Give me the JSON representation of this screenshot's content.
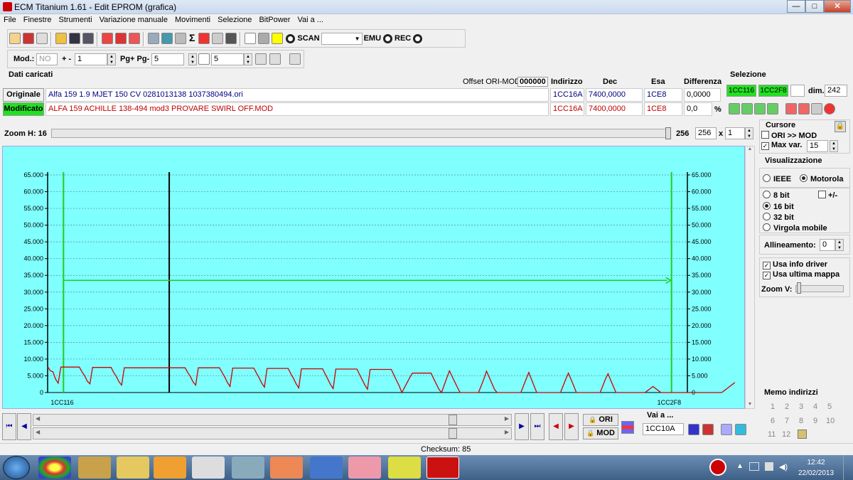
{
  "window": {
    "title": "ECM Titanium 1.61 - Edit EPROM (grafica)",
    "minimize": "—",
    "maximize": "□",
    "close": "✕"
  },
  "menu": [
    "File",
    "Finestre",
    "Strumenti",
    "Variazione manuale",
    "Movimenti",
    "Selezione",
    "BitPower",
    "Vai a ..."
  ],
  "toolbar1": {
    "scan": "SCAN",
    "emu": "EMU",
    "rec": "REC",
    "sigma": "Σ"
  },
  "toolbar2": {
    "mod_label": "Mod.:",
    "mod_value": "NO",
    "plusminus": "+ -",
    "plusminus_value": "1",
    "pg_label": "Pg+ Pg-",
    "pg_value": "5",
    "p_value": "5"
  },
  "dati": {
    "title": "Dati caricati",
    "offset_label": "Offset ORI-MOD",
    "offset_value": "000000",
    "headers": {
      "indirizzo": "Indirizzo",
      "dec": "Dec",
      "esa": "Esa",
      "differenza": "Differenza"
    },
    "originale": {
      "label": "Originale",
      "file": "Alfa 159 1.9 MJET 150 CV 0281013138 1037380494.ori",
      "indirizzo": "1CC16A",
      "dec": "7400,0000",
      "esa": "1CE8",
      "diff": "0,0000"
    },
    "modificato": {
      "label": "Modificato",
      "file": "ALFA 159 ACHILLE 138-494 mod3 PROVARE  SWIRL OFF.MOD",
      "indirizzo": "1CC16A",
      "dec": "7400,0000",
      "esa": "1CE8",
      "diff": "0,0",
      "unit": "%"
    }
  },
  "selezione": {
    "title": "Selezione",
    "start": "1CC116",
    "end": "1CC2F8",
    "dim_label": "dim.",
    "dim_value": "242"
  },
  "zoom": {
    "label": "Zoom H: 16",
    "max": "256",
    "value": "256",
    "x": "x",
    "mult": "1"
  },
  "cursore": {
    "title": "Cursore",
    "ori_mod": "ORI >> MOD",
    "max_var_label": "Max var.",
    "max_var_value": "15"
  },
  "visualizzazione": {
    "title": "Visualizzazione",
    "ieee": "IEEE",
    "motorola": "Motorola",
    "bit8": "8 bit",
    "plusminus": "+/-",
    "bit16": "16 bit",
    "bit32": "32 bit",
    "virgola": "Virgola mobile",
    "allineamento_label": "Allineamento:",
    "allineamento_value": "0",
    "usa_info": "Usa info driver",
    "usa_ultima": "Usa ultima mappa",
    "zoomv": "Zoom V:"
  },
  "memo": {
    "title": "Memo indirizzi",
    "numbers": [
      "1",
      "2",
      "3",
      "4",
      "5",
      "6",
      "7",
      "8",
      "9",
      "10",
      "11",
      "12"
    ]
  },
  "bottom": {
    "ori": "ORI",
    "mod": "MOD",
    "vai_label": "Vai a ...",
    "vai_value": "1CC10A",
    "checksum": "Checksum: 85"
  },
  "tray": {
    "time": "12:42",
    "date": "22/02/2013"
  },
  "colors": {
    "chart_bg": "#80ffff",
    "series": "#cc0000",
    "cursor": "#22cc22",
    "marker": "#000000"
  },
  "chart_data": {
    "type": "line",
    "y_ticks": [
      "65.000",
      "60.000",
      "55.000",
      "50.000",
      "45.000",
      "40.000",
      "35.000",
      "30.000",
      "25.000",
      "20.000",
      "15.000",
      "10.000",
      "5.000",
      "0"
    ],
    "ylim": [
      0,
      65000
    ],
    "xlim": [
      0,
      242
    ],
    "x_start_label": "1CC116",
    "x_end_label": "1CC2F8",
    "grid": true,
    "cursor_start_index": 6,
    "cursor_end_index": 236,
    "cursor_value": 33500,
    "marker_index": 46,
    "series": [
      {
        "values": [
          7800,
          6500,
          6200,
          4000,
          2800,
          7600,
          7600,
          7600,
          7600,
          7600,
          7600,
          7600,
          7600,
          6200,
          5000,
          3400,
          2600,
          7500,
          7500,
          7500,
          7500,
          7500,
          7500,
          7500,
          7500,
          6000,
          4800,
          3200,
          2200,
          7400,
          7400,
          7400,
          7400,
          7400,
          7400,
          7400,
          7400,
          7400,
          7400,
          7400,
          7400,
          7400,
          7400,
          7400,
          7400,
          7400,
          7400,
          7400,
          7400,
          7400,
          7400,
          7400,
          7400,
          6000,
          4800,
          3200,
          2200,
          7400,
          7400,
          7400,
          7400,
          7400,
          7400,
          7400,
          7400,
          7400,
          6000,
          4600,
          3000,
          1800,
          7300,
          7300,
          7300,
          7300,
          7300,
          7300,
          7300,
          7300,
          7300,
          5800,
          4400,
          2800,
          1600,
          7200,
          7200,
          7200,
          7200,
          7200,
          7200,
          7200,
          7200,
          7200,
          5600,
          4200,
          2600,
          1400,
          7100,
          7100,
          7100,
          7100,
          7100,
          7100,
          7100,
          7100,
          7100,
          5500,
          4000,
          2400,
          1200,
          7000,
          7000,
          7000,
          7000,
          7000,
          7000,
          7000,
          7000,
          7000,
          5400,
          3800,
          2200,
          1000,
          6900,
          6900,
          6900,
          6900,
          6900,
          6900,
          6900,
          6900,
          6900,
          5200,
          3600,
          2000,
          0,
          1500,
          3000,
          4500,
          5800,
          5800,
          5800,
          5800,
          5800,
          5800,
          5800,
          5800,
          4200,
          2600,
          1000,
          0,
          2200,
          4400,
          6500,
          4800,
          3200,
          1600,
          0,
          0,
          0,
          0,
          0,
          0,
          0,
          0,
          2000,
          4000,
          6400,
          4600,
          2800,
          1000,
          0,
          0,
          0,
          0,
          0,
          0,
          0,
          0,
          0,
          0,
          2000,
          4000,
          6000,
          4000,
          2000,
          0,
          0,
          0,
          0,
          0,
          0,
          0,
          0,
          0,
          0,
          2000,
          4000,
          5800,
          3900,
          2000,
          0,
          0,
          0,
          0,
          0,
          0,
          0,
          0,
          0,
          0,
          2000,
          4000,
          5600,
          3700,
          1800,
          0,
          0,
          0,
          0,
          0,
          0,
          0,
          0,
          0,
          0,
          0,
          0,
          600,
          1200,
          1800,
          1200,
          600,
          0,
          0,
          0,
          0,
          0,
          0,
          0,
          0,
          0,
          0,
          0,
          0,
          0,
          0,
          0,
          0,
          0,
          0,
          0,
          0,
          0,
          0,
          0,
          0,
          600,
          1200,
          1800,
          2400,
          3000
        ]
      }
    ]
  }
}
